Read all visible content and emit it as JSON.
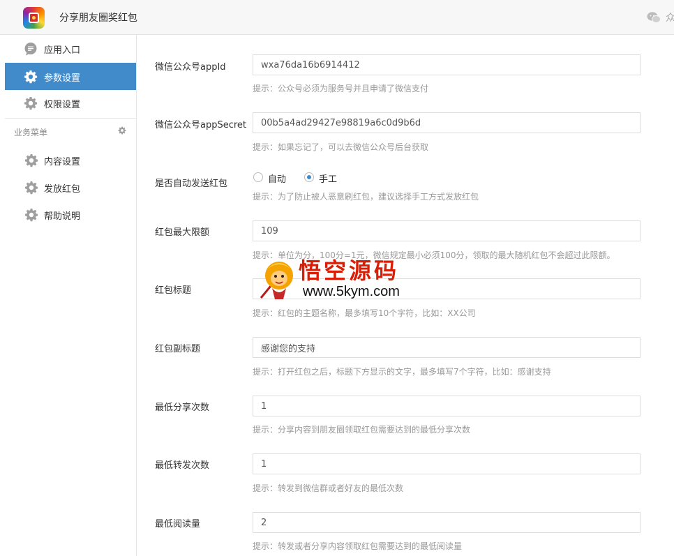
{
  "app": {
    "title": "分享朋友圈奖红包",
    "top_right_text": "众"
  },
  "sidebar": {
    "items": [
      {
        "label": "应用入口",
        "icon": "chat-bubble-icon"
      },
      {
        "label": "参数设置",
        "icon": "gear-icon",
        "active": true
      },
      {
        "label": "权限设置",
        "icon": "gear-icon"
      }
    ],
    "section_title": "业务菜单",
    "sub_items": [
      {
        "label": "内容设置",
        "icon": "gear-icon"
      },
      {
        "label": "发放红包",
        "icon": "gear-icon"
      },
      {
        "label": "帮助说明",
        "icon": "gear-icon"
      }
    ]
  },
  "form": {
    "appid": {
      "label": "微信公众号appId",
      "value": "wxa76da16b6914412",
      "hint": "提示：公众号必须为服务号并且申请了微信支付"
    },
    "appsecret": {
      "label": "微信公众号appSecret",
      "value": "00b5a4ad29427e98819a6c0d9b6d",
      "hint": "提示：如果忘记了，可以去微信公众号后台获取"
    },
    "auto_send": {
      "label": "是否自动发送红包",
      "options": [
        "自动",
        "手工"
      ],
      "selected": "手工",
      "hint": "提示：为了防止被人恶意刷红包，建议选择手工方式发放红包"
    },
    "max_amount": {
      "label": "红包最大限额",
      "value": "109",
      "hint": "提示：单位为分，100分=1元，微信规定最小必须100分，领取的最大随机红包不会超过此限额。"
    },
    "title": {
      "label": "红包标题",
      "value": "",
      "hint": "提示：红包的主题名称，最多填写10个字符，比如：XX公司"
    },
    "subtitle": {
      "label": "红包副标题",
      "value": "感谢您的支持",
      "hint": "提示：打开红包之后，标题下方显示的文字，最多填写7个字符，比如：感谢支持"
    },
    "min_share": {
      "label": "最低分享次数",
      "value": "1",
      "hint": "提示：分享内容到朋友圈领取红包需要达到的最低分享次数"
    },
    "min_forward": {
      "label": "最低转发次数",
      "value": "1",
      "hint": "提示：转发到微信群或者好友的最低次数"
    },
    "min_read": {
      "label": "最低阅读量",
      "value": "2",
      "hint": "提示：转发或者分享内容领取红包需要达到的最低阅读量"
    }
  },
  "watermark": {
    "title": "悟空源码",
    "url": "www.5kym.com"
  },
  "colors": {
    "accent": "#428bca",
    "watermark_red": "#d81e06"
  }
}
